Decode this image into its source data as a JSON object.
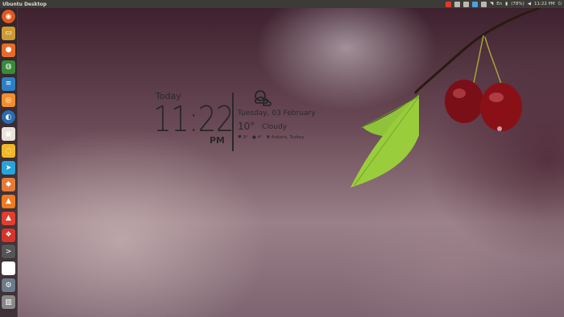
{
  "panel": {
    "title": "Ubuntu Desktop",
    "indicators": [
      "red-badge",
      "grey",
      "grey",
      "blue",
      "grey",
      "wifi",
      "keyboard",
      "sound"
    ],
    "keyboard_label": "En",
    "battery_text": "(78%)",
    "clock_text": "11:22 PM",
    "colors": {
      "panel_bg": "#3c3b37",
      "panel_text": "#dfdbd2"
    }
  },
  "launcher": {
    "items": [
      {
        "name": "dash-home"
      },
      {
        "name": "files"
      },
      {
        "name": "firefox"
      },
      {
        "name": "chrome"
      },
      {
        "name": "libreoffice-writer"
      },
      {
        "name": "ubuntu-software"
      },
      {
        "name": "chromium"
      },
      {
        "name": "software-center"
      },
      {
        "name": "gold-app"
      },
      {
        "name": "telegram"
      },
      {
        "name": "browser-orange"
      },
      {
        "name": "vlc"
      },
      {
        "name": "software-updater"
      },
      {
        "name": "ubuntu-one"
      },
      {
        "name": "terminal"
      },
      {
        "name": "picasa"
      },
      {
        "name": "settings"
      },
      {
        "name": "trash"
      }
    ]
  },
  "widget": {
    "today_label": "Today",
    "time": "11:22",
    "ampm": "PM",
    "date": "Tuesday, 03 February",
    "temperature": "10°",
    "condition": "Cloudy",
    "details": [
      "♥ 9°",
      "● 4°",
      "▼ Ankara, Turkey"
    ]
  }
}
